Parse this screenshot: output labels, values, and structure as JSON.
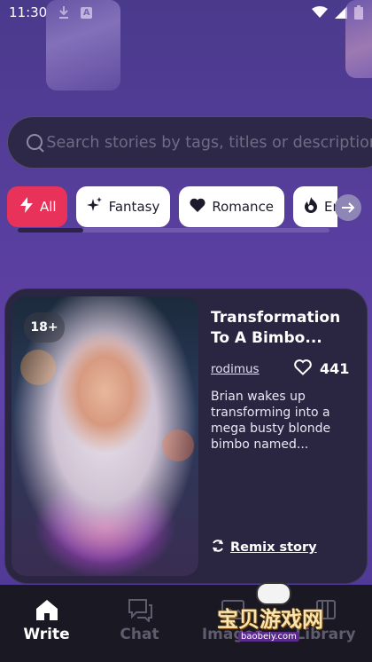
{
  "status_bar": {
    "time": "11:30"
  },
  "search": {
    "placeholder": "Search stories by tags, titles or descriptions"
  },
  "chips": [
    {
      "label": "All",
      "icon": "lightning-icon",
      "active": true
    },
    {
      "label": "Fantasy",
      "icon": "sparkles-icon",
      "active": false
    },
    {
      "label": "Romance",
      "icon": "heart-icon",
      "active": false
    },
    {
      "label": "Erotic",
      "icon": "fire-icon",
      "active": false
    }
  ],
  "story": {
    "age_badge": "18+",
    "title": "Transformation To A Bimbo...",
    "author": "rodimus",
    "likes": "441",
    "description": "Brian wakes up transforming into a mega busty blonde bimbo named...",
    "remix_label": "Remix story"
  },
  "nav": [
    {
      "label": "Write",
      "icon": "home-icon",
      "active": true
    },
    {
      "label": "Chat",
      "icon": "chat-icon",
      "active": false
    },
    {
      "label": "Images",
      "icon": "image-icon",
      "active": false
    },
    {
      "label": "Library",
      "icon": "library-icon",
      "active": false
    }
  ],
  "watermark": {
    "text": "宝贝游戏网",
    "url": "baobeiy.com"
  },
  "colors": {
    "accent": "#e8325a",
    "card": "#2a2540",
    "nav_bg": "#1a1822"
  }
}
